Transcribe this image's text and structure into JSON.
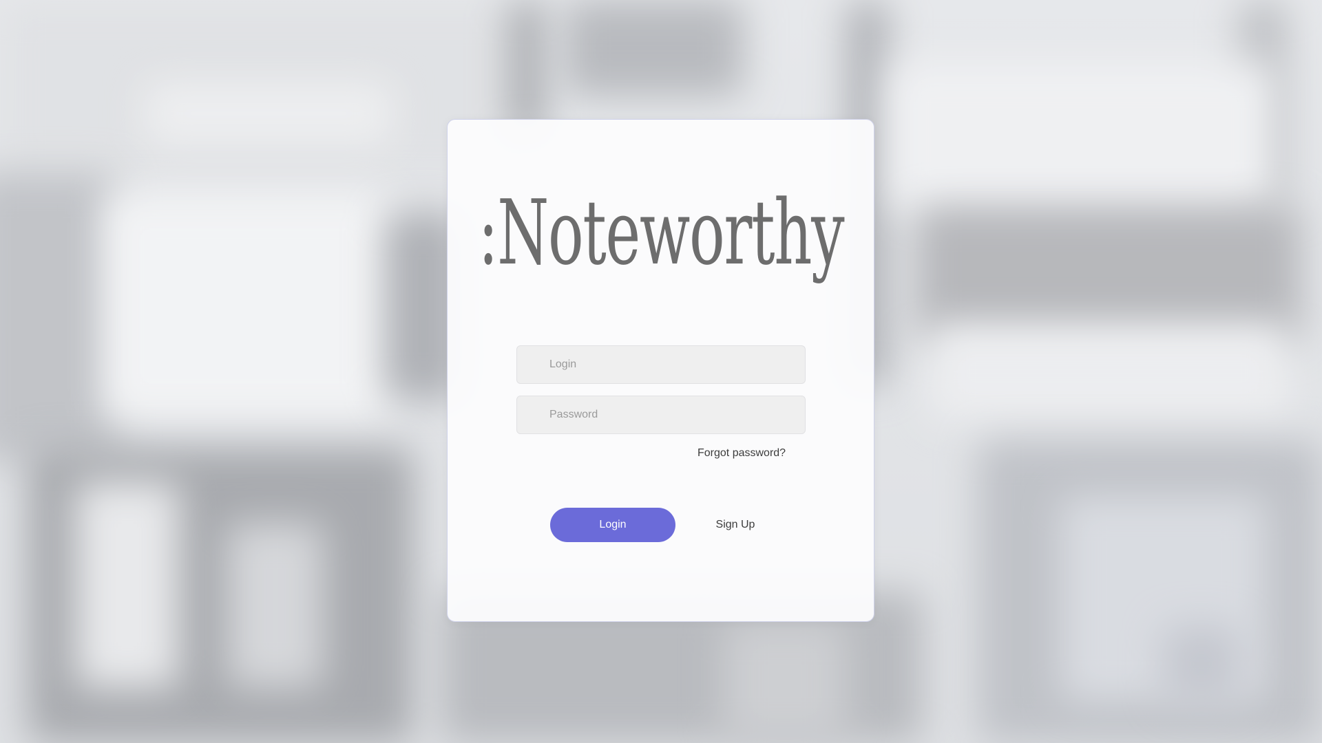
{
  "app": {
    "brand": ":Noteworthy"
  },
  "form": {
    "login_placeholder": "Login",
    "password_placeholder": "Password",
    "forgot_password": "Forgot password?",
    "login_button": "Login",
    "signup_button": "Sign Up"
  },
  "colors": {
    "accent": "#6b6bd9",
    "logo": "#6d6d6d",
    "card_border": "#cfd2ea",
    "field_bg": "#efefef"
  }
}
